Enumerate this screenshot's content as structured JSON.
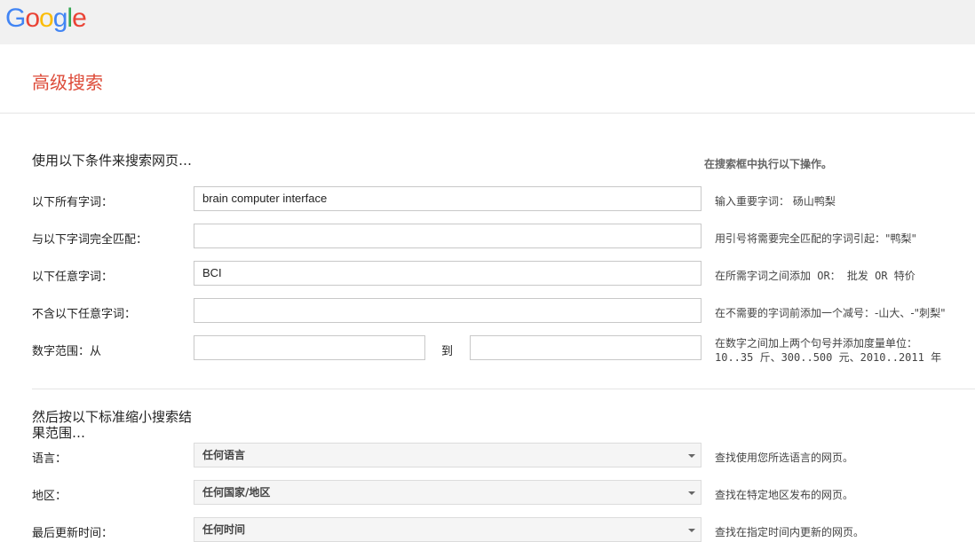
{
  "header": {
    "logo_letters": [
      {
        "ch": "G",
        "color": "#4285f4"
      },
      {
        "ch": "o",
        "color": "#ea4335"
      },
      {
        "ch": "o",
        "color": "#fbbc05"
      },
      {
        "ch": "g",
        "color": "#4285f4"
      },
      {
        "ch": "l",
        "color": "#34a853"
      },
      {
        "ch": "e",
        "color": "#ea4335"
      }
    ]
  },
  "page_title": "高级搜索",
  "section1": {
    "heading": "使用以下条件来搜索网页…",
    "hint_heading": "在搜索框中执行以下操作。",
    "rows": [
      {
        "label": "以下所有字词：",
        "value": "brain computer interface",
        "hint": "输入重要字词： 砀山鸭梨"
      },
      {
        "label": "与以下字词完全匹配：",
        "value": "",
        "hint": "用引号将需要完全匹配的字词引起：\"鸭梨\""
      },
      {
        "label": "以下任意字词：",
        "value": "BCI",
        "hint": "在所需字词之间添加 OR： 批发 OR 特价"
      },
      {
        "label": "不含以下任意字词：",
        "value": "",
        "hint": "在不需要的字词前添加一个减号：-山大、-\"刺梨\""
      }
    ],
    "range": {
      "label": "数字范围：从",
      "from_value": "",
      "to_label": "到",
      "to_value": "",
      "hint_line1": "在数字之间加上两个句号并添加度量单位：",
      "hint_line2": "10..35 斤、300..500 元、2010..2011 年"
    }
  },
  "section2": {
    "heading": "然后按以下标准缩小搜索结果范围…",
    "rows": [
      {
        "label": "语言：",
        "selected": "任何语言",
        "hint": "查找使用您所选语言的网页。"
      },
      {
        "label": "地区：",
        "selected": "任何国家/地区",
        "hint": "查找在特定地区发布的网页。"
      },
      {
        "label": "最后更新时间：",
        "selected": "任何时间",
        "hint": "查找在指定时间内更新的网页。"
      }
    ]
  }
}
